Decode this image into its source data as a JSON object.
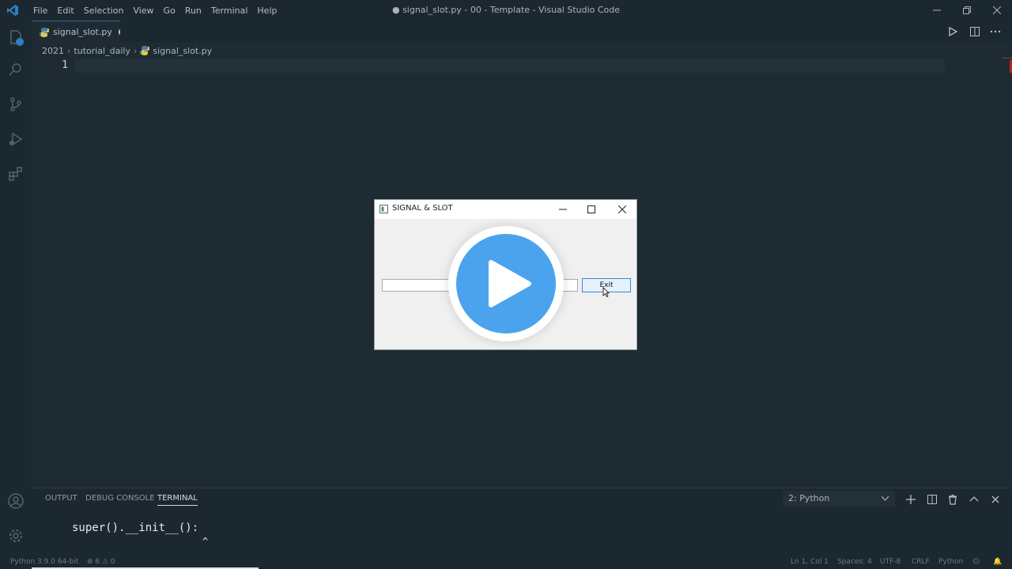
{
  "window": {
    "title": "● signal_slot.py - 00 - Template - Visual Studio Code",
    "menu": [
      "File",
      "Edit",
      "Selection",
      "View",
      "Go",
      "Run",
      "Terminal",
      "Help"
    ]
  },
  "tab": {
    "name": "signal_slot.py"
  },
  "breadcrumb": [
    "2021",
    "tutorial_daily",
    "signal_slot.py"
  ],
  "editor": {
    "line_number": "1"
  },
  "dialog": {
    "title": "SIGNAL & SLOT",
    "exit_label": "Exit"
  },
  "panel": {
    "tabs": [
      "OUTPUT",
      "DEBUG CONSOLE",
      "TERMINAL"
    ],
    "active_tab": "TERMINAL",
    "terminal_select": "2: Python",
    "terminal_text": "super().__init__():",
    "caret_text": "^"
  },
  "status": {
    "python": "Python 3.9.0 64-bit",
    "problems": "⊗ 6  ⚠ 0",
    "position": "Ln 1, Col 1",
    "spaces": "Spaces: 4",
    "encoding": "UTF-8",
    "eol": "CRLF",
    "language": "Python"
  },
  "colors": {
    "accent": "#4aa3ec",
    "background": "#1f2b33"
  }
}
